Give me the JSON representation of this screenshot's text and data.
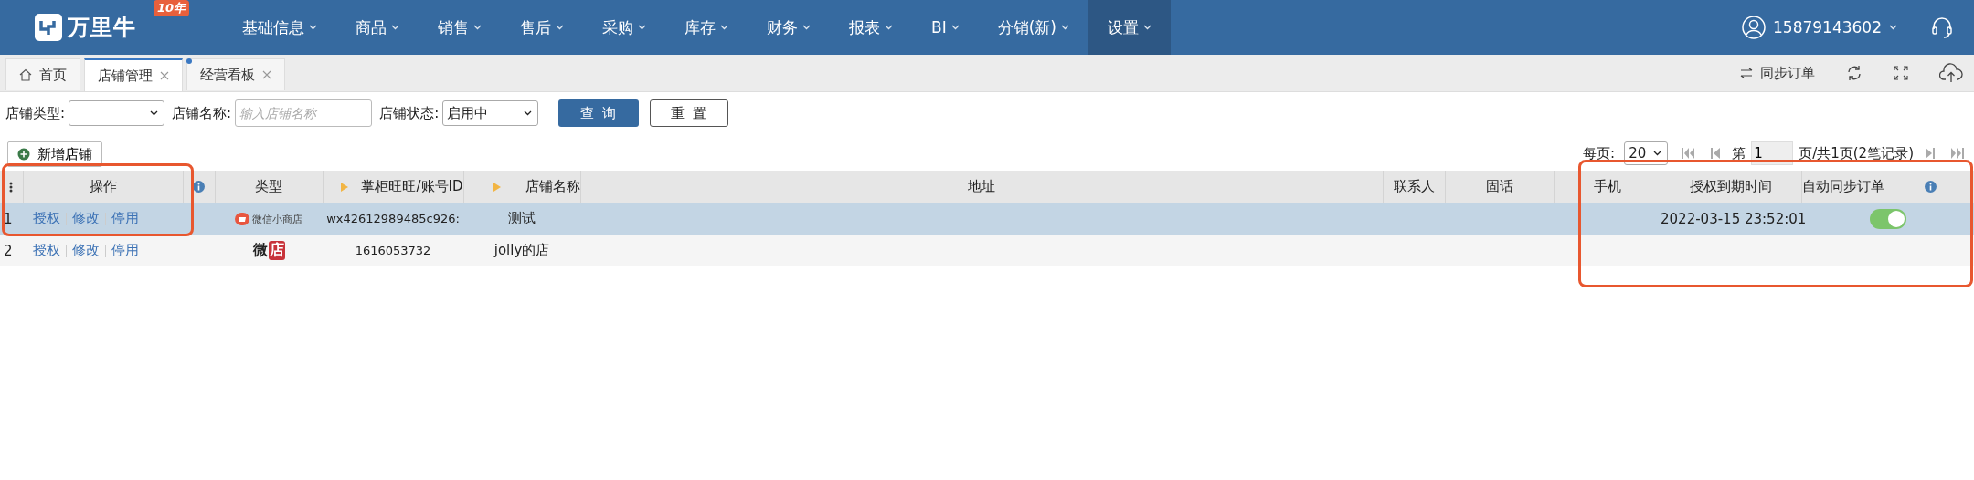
{
  "app": {
    "logo_text": "万里牛",
    "badge_text": "10年"
  },
  "nav": [
    {
      "label": "基础信息",
      "selected": false
    },
    {
      "label": "商品",
      "selected": false
    },
    {
      "label": "销售",
      "selected": false
    },
    {
      "label": "售后",
      "selected": false
    },
    {
      "label": "采购",
      "selected": false
    },
    {
      "label": "库存",
      "selected": false
    },
    {
      "label": "财务",
      "selected": false
    },
    {
      "label": "报表",
      "selected": false
    },
    {
      "label": "BI",
      "selected": false
    },
    {
      "label": "分销(新)",
      "selected": false
    },
    {
      "label": "设置",
      "selected": true
    }
  ],
  "user": {
    "name": "15879143602"
  },
  "tabs": [
    {
      "label": "首页",
      "kind": "home",
      "selected": false
    },
    {
      "label": "店铺管理",
      "kind": "closable",
      "selected": true
    },
    {
      "label": "经营看板",
      "kind": "closable",
      "selected": false,
      "dot": true
    }
  ],
  "toolbar": {
    "sync_label": "同步订单"
  },
  "filters": [
    {
      "label": "店铺类型:",
      "kind": "select"
    },
    {
      "label": "店铺名称:",
      "kind": "input",
      "placeholder": "输入店铺名称"
    },
    {
      "label": "店铺状态:",
      "kind": "select",
      "value": "启用中"
    }
  ],
  "buttons": [
    {
      "label": "查 询",
      "kind": "primary"
    },
    {
      "label": "重 置",
      "kind": "plain"
    }
  ],
  "add_button": "新增店铺",
  "pager": {
    "per_page_label": "每页:",
    "per_page": "20",
    "page_label": "第",
    "page": "1",
    "total": "页/共1页(2笔记录)"
  },
  "table": {
    "columns": [
      {
        "kind": "menu-icon"
      },
      {
        "kind": "text",
        "label": "操作"
      },
      {
        "kind": "info-icon"
      },
      {
        "kind": "text",
        "label": "类型"
      },
      {
        "kind": "text",
        "label": "掌柜旺旺/账号ID",
        "marker": true
      },
      {
        "kind": "text",
        "label": "店铺名称",
        "marker": true
      },
      {
        "kind": "text",
        "label": "地址"
      },
      {
        "kind": "text",
        "label": "联系人"
      },
      {
        "kind": "text",
        "label": "固话"
      },
      {
        "kind": "text",
        "label": "手机"
      },
      {
        "kind": "text",
        "label": "授权到期时间"
      },
      {
        "kind": "text",
        "label": "自动同步订单",
        "info": true
      }
    ],
    "rows": [
      {
        "number": "1",
        "selected": true,
        "actions": [
          "授权",
          "修改",
          "停用"
        ],
        "type": {
          "kind": "mini-store",
          "text": "微信小商店"
        },
        "account": "wx42612989485c926:",
        "store": "测试",
        "expires": "2022-03-15 23:52:01",
        "auto_sync": {
          "on": true
        }
      },
      {
        "number": "2",
        "selected": false,
        "actions": [
          "授权",
          "修改",
          "停用"
        ],
        "type": {
          "kind": "weidian",
          "text": "微",
          "badge": "店"
        },
        "account": "1616053732",
        "store": "jolly的店"
      }
    ]
  },
  "highlights": [
    {
      "kind": "frame"
    },
    {
      "kind": "frame"
    }
  ]
}
